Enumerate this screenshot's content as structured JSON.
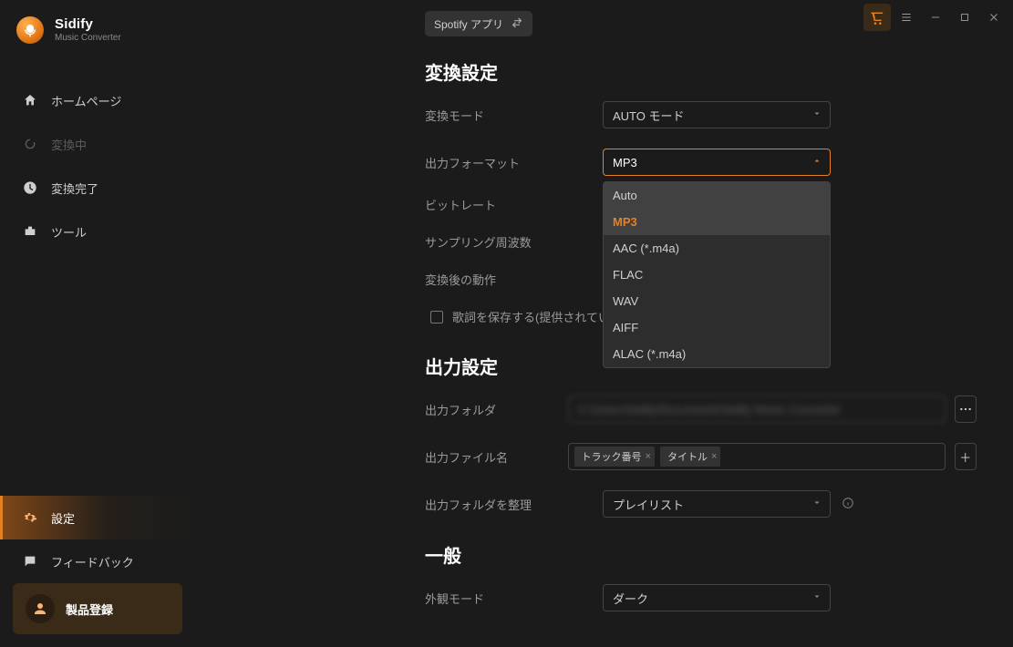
{
  "brand": {
    "title": "Sidify",
    "subtitle": "Music Converter"
  },
  "sidebar": {
    "home": "ホームページ",
    "converting": "変換中",
    "done": "変換完了",
    "tools": "ツール",
    "settings": "設定",
    "feedback": "フィードバック",
    "register": "製品登録"
  },
  "source_chip": "Spotify アプリ",
  "sections": {
    "conversion": "変換設定",
    "output": "出力設定",
    "general": "一般"
  },
  "labels": {
    "mode": "変換モード",
    "format": "出力フォーマット",
    "bitrate": "ビットレート",
    "samplerate": "サンプリング周波数",
    "after": "変換後の動作",
    "save_lyrics": "歌詞を保存する(提供されてい",
    "out_folder": "出力フォルダ",
    "out_name": "出力ファイル名",
    "organize": "出力フォルダを整理",
    "appearance": "外観モード"
  },
  "values": {
    "mode": "AUTO モード",
    "format": "MP3",
    "out_path": "C:\\Users\\Sidify\\Documents\\Sidify Music Converter",
    "organize": "プレイリスト",
    "appearance": "ダーク"
  },
  "format_options": [
    "Auto",
    "MP3",
    "AAC (*.m4a)",
    "FLAC",
    "WAV",
    "AIFF",
    "ALAC (*.m4a)"
  ],
  "filename_tags": [
    "トラック番号",
    "タイトル"
  ]
}
